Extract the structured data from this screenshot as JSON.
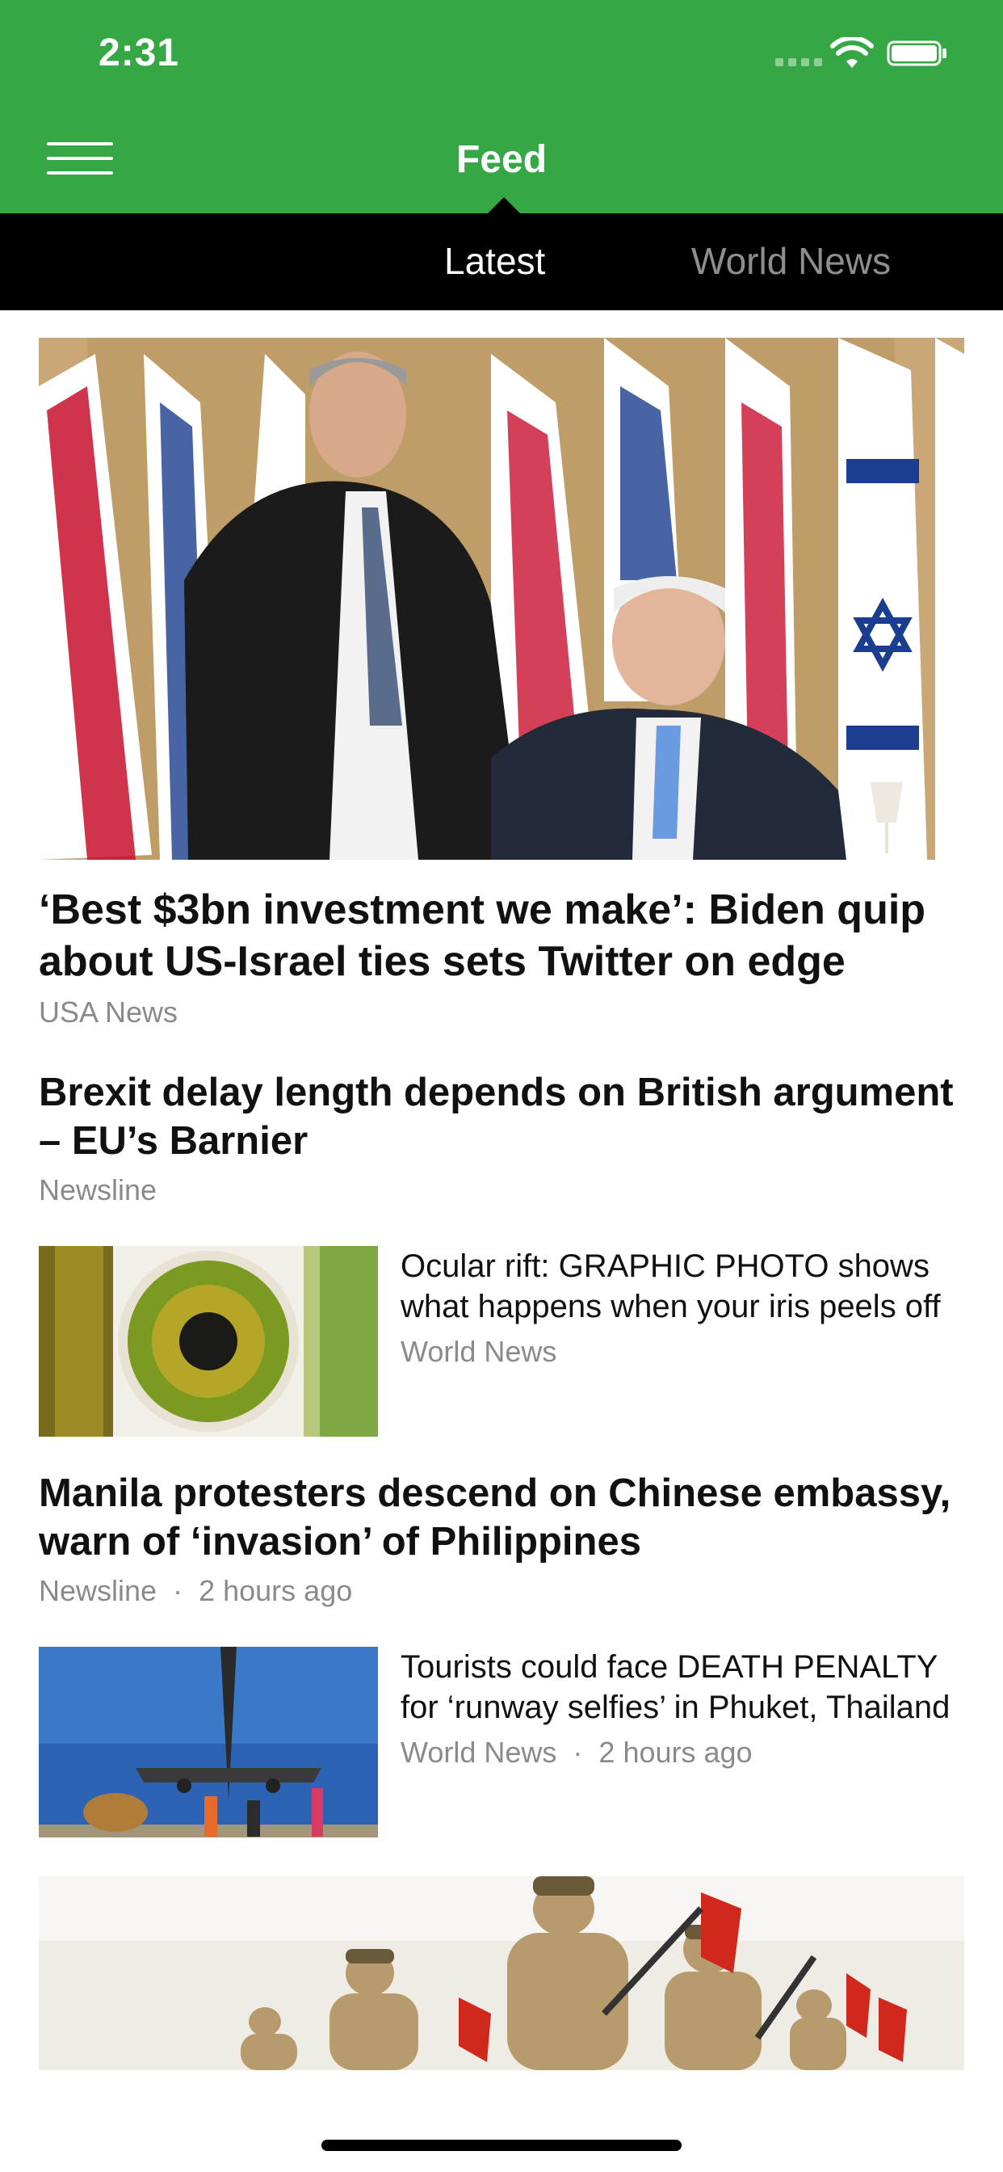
{
  "status": {
    "time": "2:31"
  },
  "nav": {
    "title": "Feed"
  },
  "tabs": [
    {
      "label": "Latest"
    },
    {
      "label": "World News"
    }
  ],
  "articles": [
    {
      "title": "‘Best $3bn investment we make’: Biden quip about US-Israel ties sets Twitter on edge",
      "source": "USA News",
      "time": "",
      "image": "flags-leaders-photo"
    },
    {
      "title": "Brexit delay length depends on British argument – EU’s Barnier",
      "source": "Newsline",
      "time": ""
    },
    {
      "title": "Ocular rift: GRAPHIC PHOTO shows what happens when your iris peels off",
      "source": "World News",
      "time": "",
      "image": "eye-photo"
    },
    {
      "title": "Manila protesters descend on Chinese embassy, warn of ‘invasion’ of Philippines",
      "source": "Newsline",
      "time": "2 hours ago"
    },
    {
      "title": "Tourists could face DEATH PENALTY for ‘runway selfies’ in Phuket, Thailand",
      "source": "World News",
      "time": "2 hours ago",
      "image": "plane-photo"
    },
    {
      "title": "",
      "source": "",
      "time": "",
      "image": "military-parade-photo"
    }
  ],
  "meta_separator": "·",
  "colors": {
    "brand_green": "#35A744",
    "tab_bar": "#000000",
    "meta_gray": "#8a8a8a"
  }
}
